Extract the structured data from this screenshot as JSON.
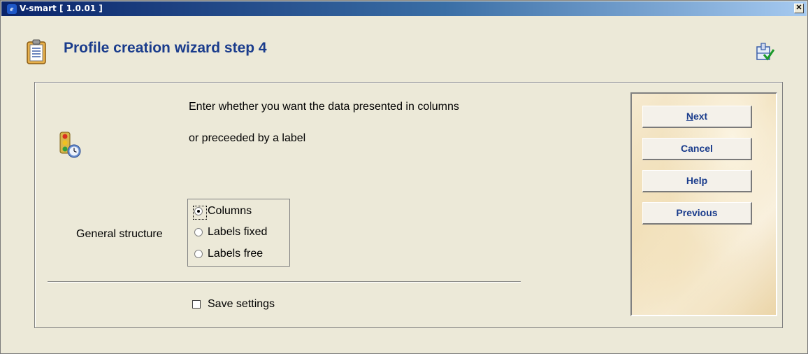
{
  "window": {
    "title": "V-smart [ 1.0.01 ]",
    "close_glyph": "✕"
  },
  "header": {
    "title": "Profile creation wizard step 4",
    "icon": "clipboard-icon",
    "corner_icon": "wizard-check-icon"
  },
  "content": {
    "icon": "traffic-light-icon",
    "description_line1": "Enter whether you want the data presented in columns",
    "description_line2": "or preceeded by a label",
    "field_label": "General structure",
    "options": [
      {
        "label": "Columns",
        "selected": true
      },
      {
        "label": "Labels fixed",
        "selected": false
      },
      {
        "label": "Labels free",
        "selected": false
      }
    ],
    "save_settings_label": "Save settings",
    "save_settings_checked": false
  },
  "buttons": {
    "next_label": "Next",
    "cancel_label": "Cancel",
    "help_label": "Help",
    "previous_label": "Previous"
  }
}
